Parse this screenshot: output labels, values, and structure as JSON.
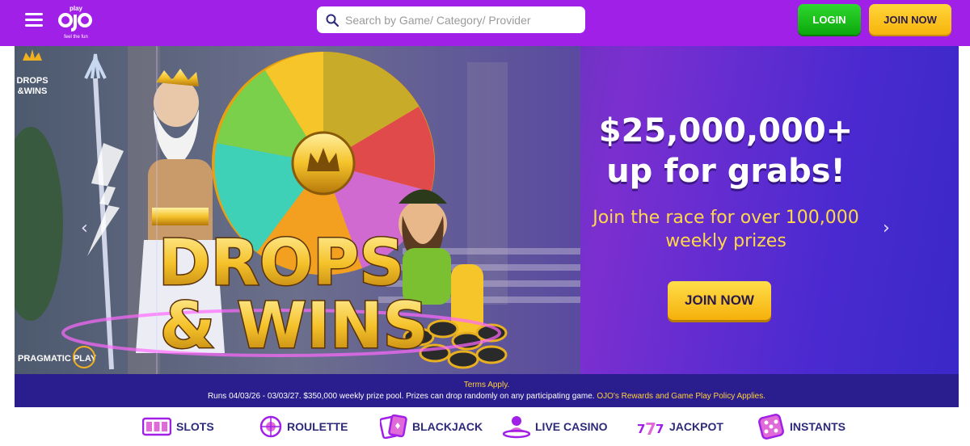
{
  "header": {
    "logo_text": "play ojo feel the fun",
    "search_placeholder": "Search by Game/ Category/ Provider",
    "login_label": "LOGIN",
    "join_label": "JOIN NOW"
  },
  "hero": {
    "badge": "DROPS & WINS",
    "title_art": "DROPS & WINS",
    "provider": "PRAGMATIC PLAY",
    "headline_line1": "$25,000,000+",
    "headline_line2": "up for grabs!",
    "sub_line1": "Join the race for over 100,000",
    "sub_line2": "weekly prizes",
    "cta_label": "JOIN NOW",
    "prev_glyph": "‹",
    "next_glyph": "›"
  },
  "terms": {
    "line1": "Terms Apply.",
    "line2_main": "Runs 04/03/26 - 03/03/27. $350,000 weekly prize pool. Prizes can drop randomly on any participating game.",
    "line2_link": "OJO's Rewards and Game Play Policy Applies."
  },
  "categories": [
    {
      "label": "SLOTS",
      "icon": "slots-icon"
    },
    {
      "label": "ROULETTE",
      "icon": "roulette-icon"
    },
    {
      "label": "BLACKJACK",
      "icon": "cards-icon"
    },
    {
      "label": "LIVE CASINO",
      "icon": "dealer-icon"
    },
    {
      "label": "JACKPOT",
      "icon": "777-icon"
    },
    {
      "label": "INSTANTS",
      "icon": "dice-icon"
    }
  ],
  "colors": {
    "header_bg": "#a020e8",
    "login_green": "#1fc51f",
    "join_yellow": "#fbc420",
    "terms_bg": "#2a1d8e",
    "category_text": "#2d2a7a",
    "category_icon": "#a020e8"
  }
}
